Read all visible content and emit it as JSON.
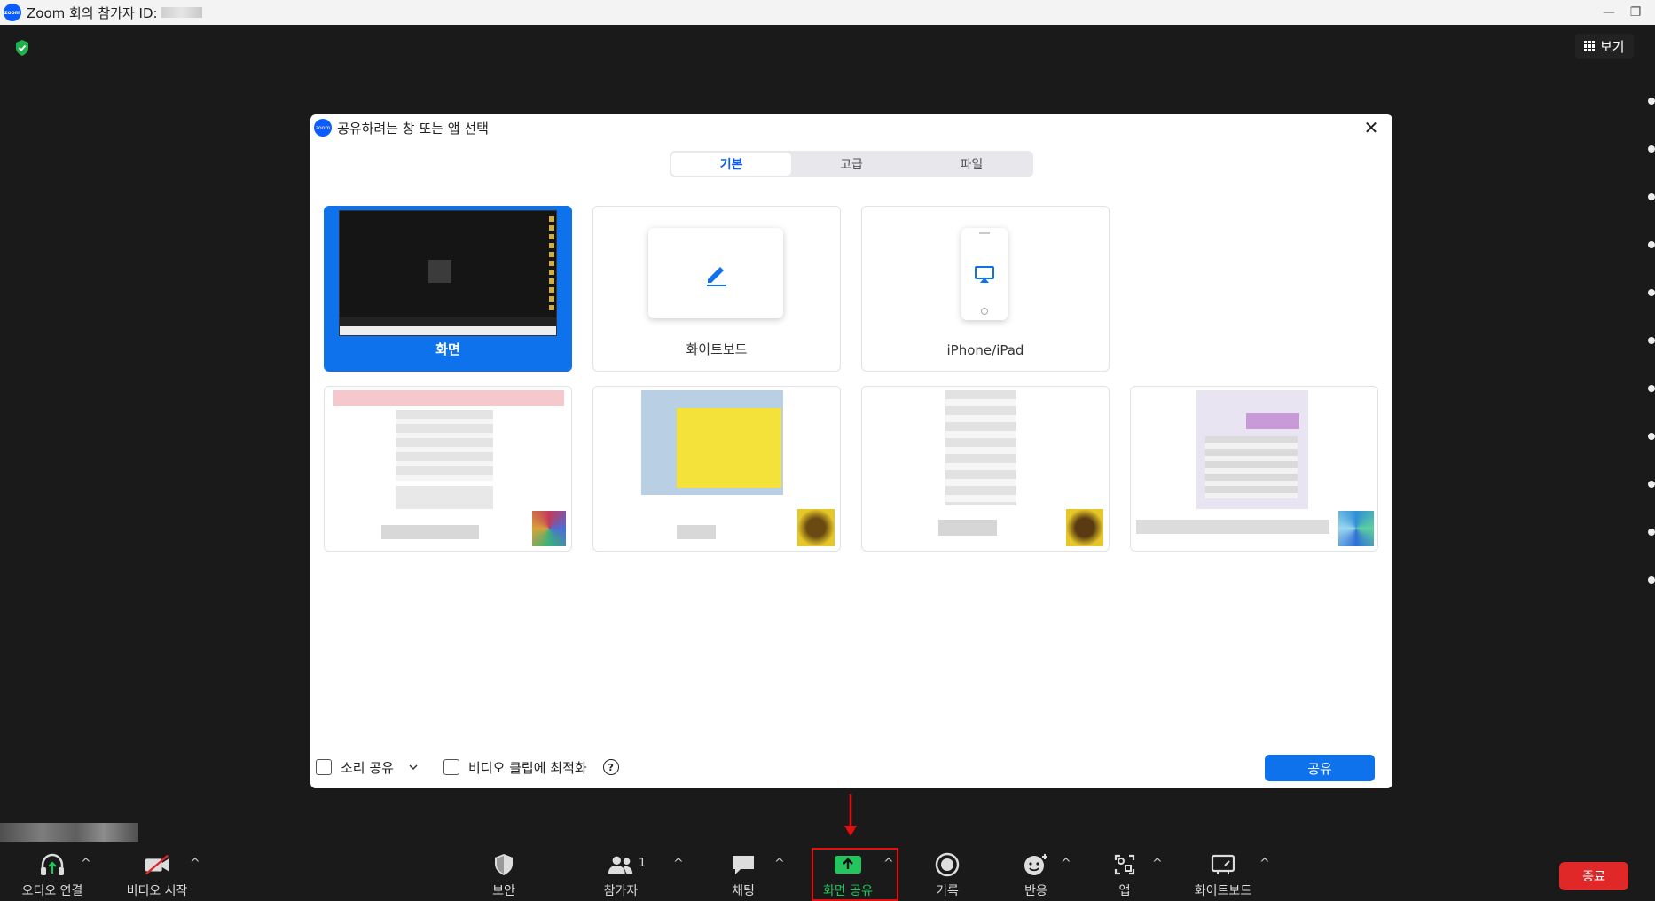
{
  "window": {
    "title": "Zoom 회의 참가자 ID:",
    "logo_text": "zoom",
    "minimize": "—",
    "restore": "❐"
  },
  "meeting": {
    "view_label": "보기"
  },
  "dialog": {
    "title": "공유하려는 창 또는 앱 선택",
    "close": "✕",
    "tabs": [
      {
        "label": "기본",
        "active": true
      },
      {
        "label": "고급",
        "active": false
      },
      {
        "label": "파일",
        "active": false
      }
    ],
    "tiles": [
      {
        "label": "화면",
        "selected": true
      },
      {
        "label": "화이트보드",
        "selected": false
      },
      {
        "label": "iPhone/iPad",
        "selected": false
      }
    ],
    "footer": {
      "share_sound": "소리 공유",
      "optimize_video": "비디오 클립에 최적화",
      "help": "?",
      "share_button": "공유"
    }
  },
  "toolbar": {
    "audio": "오디오 연결",
    "video": "비디오 시작",
    "security": "보안",
    "participants": "참가자",
    "participants_count": "1",
    "chat": "채팅",
    "share_screen": "화면 공유",
    "record": "기록",
    "reactions": "반응",
    "apps": "앱",
    "whiteboard": "화이트보드",
    "end": "종료"
  },
  "colors": {
    "accent_blue": "#0e72ed",
    "share_green": "#22c55e",
    "end_red": "#e02828",
    "highlight_red": "#e01010"
  }
}
